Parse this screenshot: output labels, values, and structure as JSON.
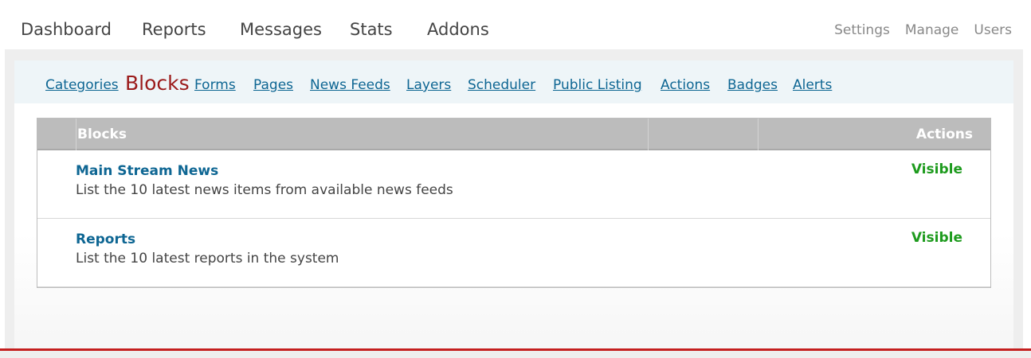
{
  "main_nav": {
    "items": [
      {
        "label": "Dashboard"
      },
      {
        "label": "Reports"
      },
      {
        "label": "Messages"
      },
      {
        "label": "Stats"
      },
      {
        "label": "Addons"
      }
    ]
  },
  "sub_nav": {
    "items": [
      {
        "label": "Settings"
      },
      {
        "label": "Manage"
      },
      {
        "label": "Users"
      }
    ]
  },
  "tabs": {
    "items": [
      {
        "label": "Categories"
      },
      {
        "label": "Blocks",
        "active": true
      },
      {
        "label": "Forms"
      },
      {
        "label": "Pages"
      },
      {
        "label": "News Feeds"
      },
      {
        "label": "Layers"
      },
      {
        "label": "Scheduler"
      },
      {
        "label": "Public Listing"
      },
      {
        "label": "Actions"
      },
      {
        "label": "Badges"
      },
      {
        "label": "Alerts"
      }
    ]
  },
  "table": {
    "headers": {
      "blocks": "Blocks",
      "actions": "Actions"
    },
    "rows": [
      {
        "title": "Main Stream News",
        "description": "List the 10 latest news items from available news feeds",
        "action": "Visible"
      },
      {
        "title": "Reports",
        "description": "List the 10 latest reports in the system",
        "action": "Visible"
      }
    ]
  },
  "colors": {
    "accent_link": "#0e6693",
    "active_tab": "#9b1a1a",
    "visible_status": "#1e9b1e",
    "bottom_rule": "#c41e1e"
  }
}
